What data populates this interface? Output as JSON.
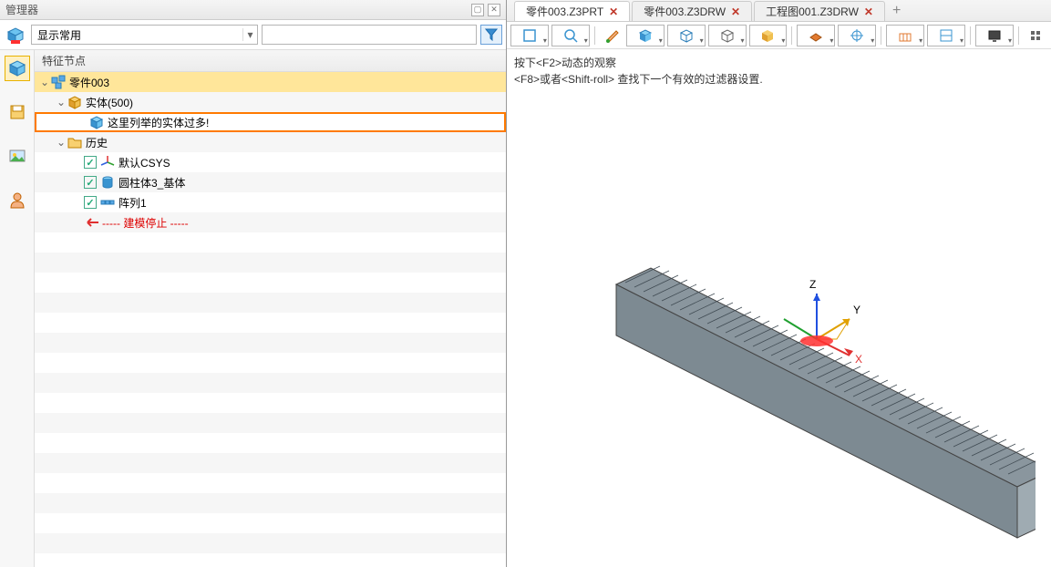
{
  "panel": {
    "title": "管理器"
  },
  "toolbar": {
    "display_label": "显示常用"
  },
  "tree": {
    "header": "特征节点",
    "root": "零件003",
    "solids": "实体(500)",
    "too_many": "这里列举的实体过多!",
    "history": "历史",
    "csys": "默认CSYS",
    "cylinder": "圆柱体3_基体",
    "pattern": "阵列1",
    "stop": "----- 建模停止 -----"
  },
  "tabs": [
    {
      "label": "零件003.Z3PRT",
      "active": true
    },
    {
      "label": "零件003.Z3DRW",
      "active": false
    },
    {
      "label": "工程图001.Z3DRW",
      "active": false
    }
  ],
  "hints": {
    "line1": "按下<F2>动态的观察",
    "line2": "<F8>或者<Shift-roll> 查找下一个有效的过滤器设置."
  },
  "axes": {
    "x": "X",
    "y": "Y",
    "z": "Z"
  }
}
